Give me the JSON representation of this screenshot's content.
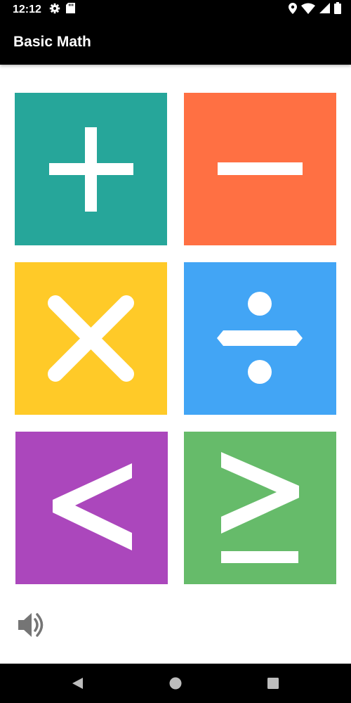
{
  "status_bar": {
    "time": "12:12",
    "icons_left": [
      "gear-icon",
      "sd-card-icon"
    ],
    "icons_right": [
      "location-icon",
      "wifi-icon",
      "signal-icon",
      "battery-icon"
    ]
  },
  "app_bar": {
    "title": "Basic Math"
  },
  "tiles": [
    {
      "name": "addition",
      "symbol": "plus-icon",
      "color": "#26A69A"
    },
    {
      "name": "subtraction",
      "symbol": "minus-icon",
      "color": "#FF7043"
    },
    {
      "name": "multiplication",
      "symbol": "times-icon",
      "color": "#FFCA28"
    },
    {
      "name": "division",
      "symbol": "divide-icon",
      "color": "#42A5F5"
    },
    {
      "name": "less-than",
      "symbol": "less-than-icon",
      "color": "#AB47BC"
    },
    {
      "name": "greater-or-equal",
      "symbol": "greater-equal-icon",
      "color": "#66BB6A"
    }
  ],
  "sound_button": {
    "icon": "volume-icon",
    "color": "#757575"
  },
  "nav_bar": {
    "icons": [
      "back-icon",
      "home-icon",
      "recent-apps-icon"
    ]
  }
}
